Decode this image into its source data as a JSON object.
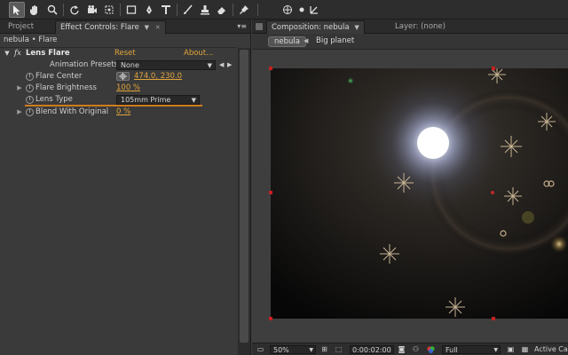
{
  "toolbar": {
    "icons": [
      "selection-arrow-icon",
      "hand-icon",
      "zoom-icon",
      "rotate-icon",
      "camera-orbit-icon",
      "pan-behind-icon",
      "rectangle-mask-icon",
      "pen-icon",
      "text-icon",
      "brush-icon",
      "clone-stamp-icon",
      "eraser-icon",
      "puppet-pin-icon",
      "axis-local-icon",
      "axis-world-icon",
      "axis-view-icon"
    ]
  },
  "left_panel": {
    "tabs": {
      "project": "Project",
      "effect_controls": "Effect Controls: Flare"
    },
    "breadcrumb": "nebula • Flare",
    "effect": {
      "fx_badge": "fx",
      "name": "Lens Flare",
      "reset": "Reset",
      "about": "About...",
      "animation_presets_label": "Animation Presets:",
      "animation_presets_value": "None",
      "flare_center_label": "Flare Center",
      "flare_center_value": "474.0, 230.0",
      "flare_brightness_label": "Flare Brightness",
      "flare_brightness_value": "100 %",
      "lens_type_label": "Lens Type",
      "lens_type_value": "105mm Prime",
      "blend_label": "Blend With Original",
      "blend_value": "0 %"
    }
  },
  "right_panel": {
    "tabs": {
      "composition": "Composition: nebula",
      "layer": "Layer: (none)"
    },
    "subtabs": {
      "nebula": "nebula",
      "big_planet": "Big planet"
    },
    "bottom": {
      "zoom": "50%",
      "timecode": "0:00:02:00",
      "resolution": "Full",
      "camera": "Active Ca"
    }
  }
}
